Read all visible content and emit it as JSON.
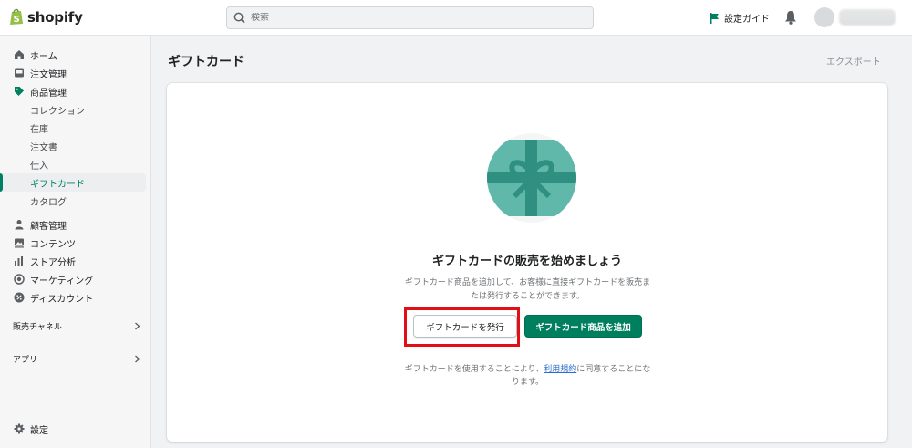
{
  "brand": {
    "name": "shopify",
    "color": "#95bf47"
  },
  "search": {
    "placeholder": "検索"
  },
  "header": {
    "setup_guide": "設定ガイド"
  },
  "sidebar": {
    "items": [
      {
        "label": "ホーム",
        "icon": "home-icon"
      },
      {
        "label": "注文管理",
        "icon": "inbox-icon"
      },
      {
        "label": "商品管理",
        "icon": "tag-icon"
      },
      {
        "label": "コレクション"
      },
      {
        "label": "在庫"
      },
      {
        "label": "注文書"
      },
      {
        "label": "仕入"
      },
      {
        "label": "ギフトカード",
        "active": true
      },
      {
        "label": "カタログ"
      },
      {
        "label": "顧客管理",
        "icon": "person-icon"
      },
      {
        "label": "コンテンツ",
        "icon": "image-icon"
      },
      {
        "label": "ストア分析",
        "icon": "bar-chart-icon"
      },
      {
        "label": "マーケティング",
        "icon": "target-icon"
      },
      {
        "label": "ディスカウント",
        "icon": "discount-icon"
      }
    ],
    "sales_channels": "販売チャネル",
    "apps": "アプリ",
    "settings": "設定"
  },
  "page": {
    "title": "ギフトカード",
    "export": "エクスポート"
  },
  "empty_state": {
    "heading": "ギフトカードの販売を始めましょう",
    "description": "ギフトカード商品を追加して、お客様に直接ギフトカードを販売または発行することができます。",
    "issue_button": "ギフトカードを発行",
    "add_button": "ギフトカード商品を追加",
    "terms_before": "ギフトカードを使用することにより、",
    "terms_link": "利用規約",
    "terms_after": "に同意することになります。"
  },
  "colors": {
    "accent": "#008060",
    "primary_button": "#007f5f",
    "highlight": "#e20f16",
    "gift_card": "#5fb8a9",
    "gift_ribbon": "#2f8f80"
  }
}
